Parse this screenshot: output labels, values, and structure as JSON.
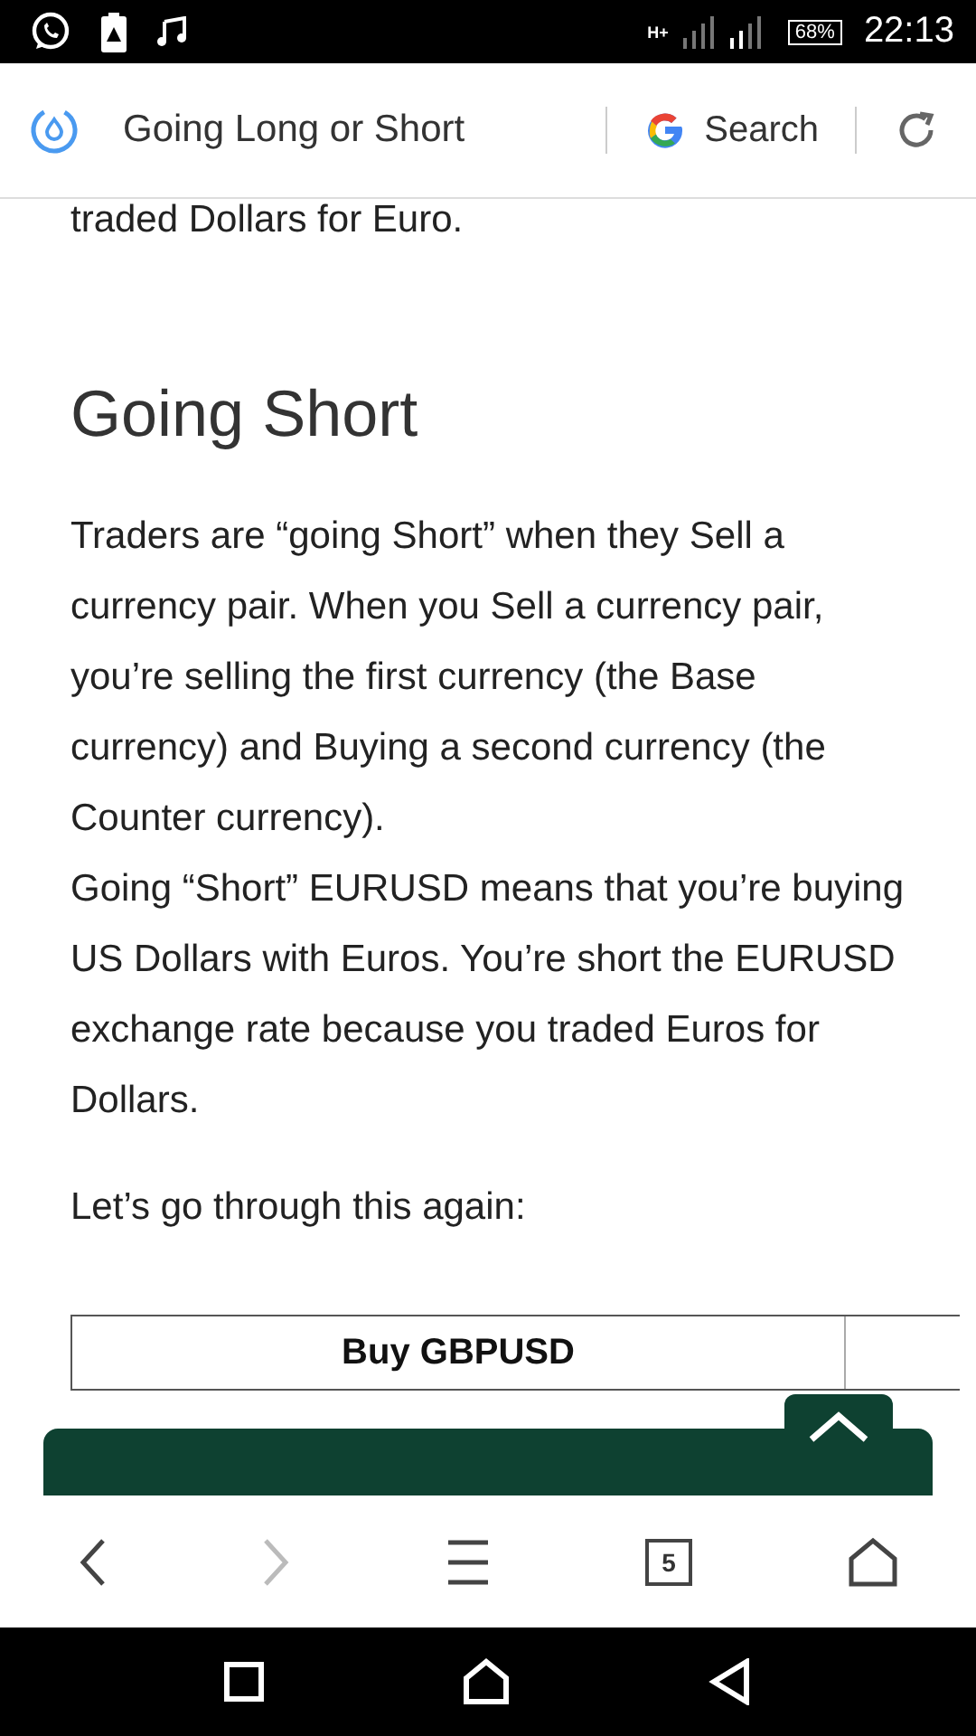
{
  "status_bar": {
    "battery": "68%",
    "time": "22:13",
    "network": "H+"
  },
  "address_bar": {
    "title": "Going Long or Short",
    "search_label": "Search"
  },
  "article": {
    "intro_end": "traded Dollars for Euro.",
    "heading": "Going Short",
    "paragraphs": [
      "Traders are “going Short” when they Sell a currency pair. When you Sell a currency pair, you’re selling the first currency (the Base currency) and Buying a second currency (the Counter currency).",
      "Going “Short” EURUSD means that you’re buying US Dollars with Euros. You’re short the EURUSD exchange rate because you traded Euros for Dollars."
    ],
    "lead_in": "Let’s go through this again:",
    "table": {
      "columns": [
        "Buy GBPUSD"
      ]
    }
  },
  "toolbar": {
    "tab_count": "5",
    "forward_disabled": true
  }
}
